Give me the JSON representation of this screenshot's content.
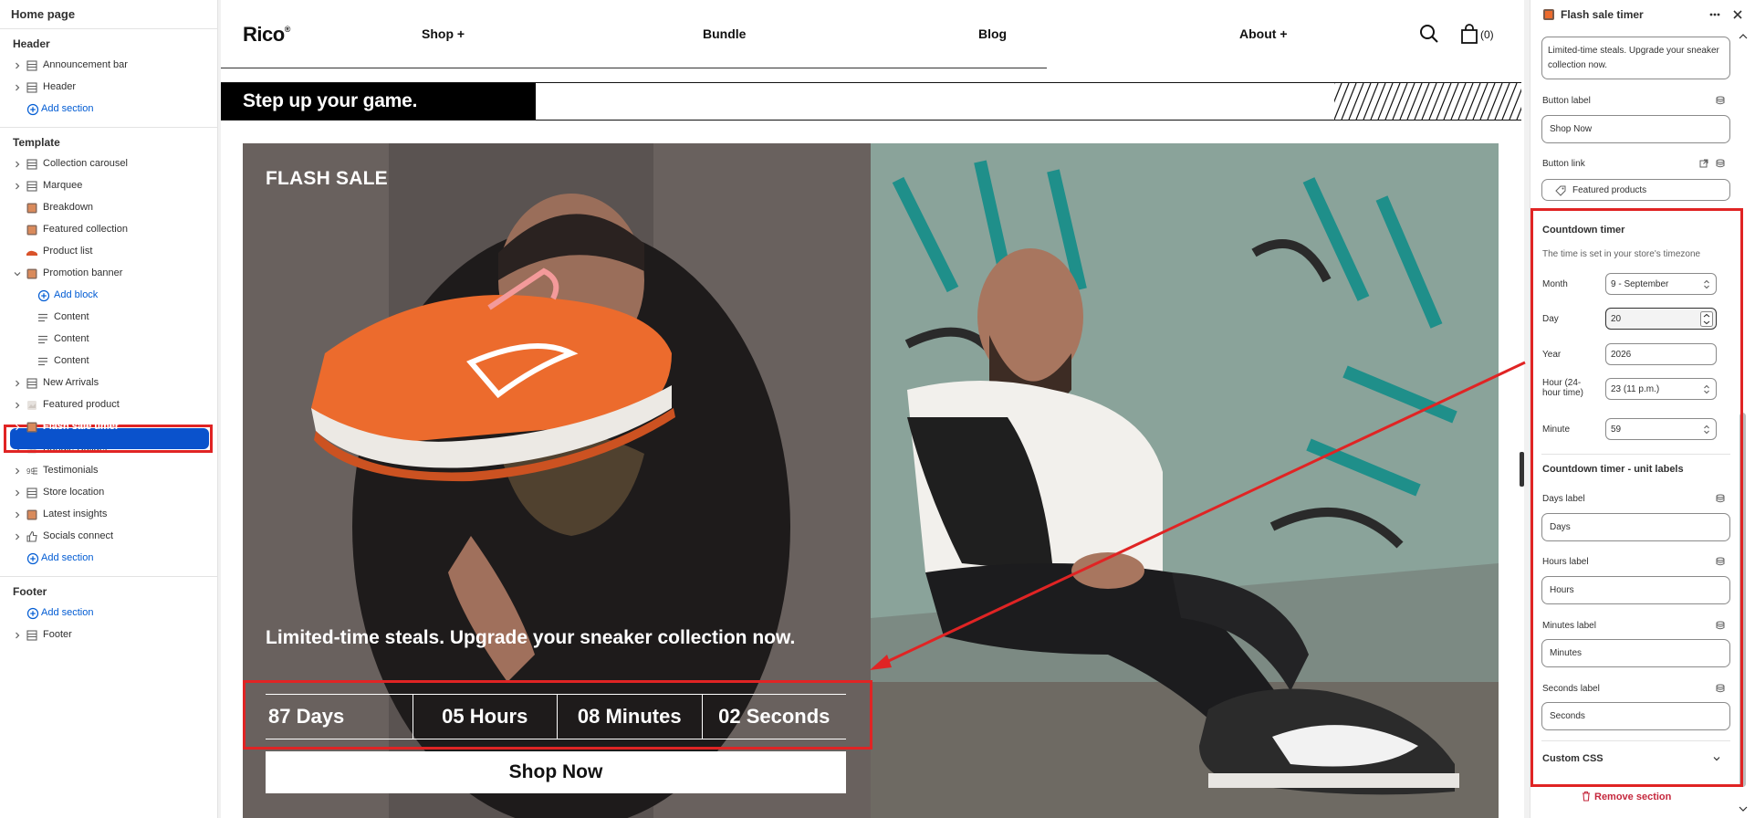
{
  "sidebar": {
    "page_title": "Home page",
    "header_group": {
      "title": "Header",
      "items": [
        {
          "label": "Announcement bar",
          "icon": "section-icon"
        },
        {
          "label": "Header",
          "icon": "section-icon"
        }
      ],
      "add_label": "Add section"
    },
    "template_group": {
      "title": "Template",
      "items": [
        {
          "label": "Collection carousel",
          "icon": "section-icon"
        },
        {
          "label": "Marquee",
          "icon": "section-icon"
        },
        {
          "label": "Breakdown",
          "icon": "image-icon"
        },
        {
          "label": "Featured collection",
          "icon": "image-icon"
        },
        {
          "label": "Product list",
          "icon": "shoe-icon"
        },
        {
          "label": "Promotion banner",
          "icon": "image-icon"
        },
        {
          "label": "Add block",
          "icon": "add-icon"
        },
        {
          "label": "Content",
          "icon": "text-icon"
        },
        {
          "label": "Content",
          "icon": "text-icon"
        },
        {
          "label": "Content",
          "icon": "text-icon"
        },
        {
          "label": "New Arrivals",
          "icon": "section-icon"
        },
        {
          "label": "Featured product",
          "icon": "product-icon"
        },
        {
          "label": "Flash sale timer",
          "icon": "image-icon"
        },
        {
          "label": "Bundle Builder",
          "icon": "product-icon"
        },
        {
          "label": "Testimonials",
          "icon": "list-icon"
        },
        {
          "label": "Store location",
          "icon": "section-icon"
        },
        {
          "label": "Latest insights",
          "icon": "image-icon"
        },
        {
          "label": "Socials connect",
          "icon": "thumb-icon"
        }
      ],
      "add_label": "Add section"
    },
    "footer_group": {
      "title": "Footer",
      "add_label": "Add section",
      "items": [
        {
          "label": "Footer",
          "icon": "section-icon"
        }
      ]
    }
  },
  "preview": {
    "logo": "Rico",
    "logo_mark": "®",
    "nav": [
      "Shop +",
      "Bundle",
      "Blog",
      "About +"
    ],
    "cart_count": "(0)",
    "marquee_text": "Step up your game.",
    "banner": {
      "title": "FLASH SALE",
      "text": "Limited-time steals. Upgrade your sneaker collection now.",
      "timer": [
        "87 Days",
        "05 Hours",
        "08 Minutes",
        "02 Seconds"
      ],
      "button": "Shop Now"
    }
  },
  "settings": {
    "title": "Flash sale timer",
    "text_value": "Limited-time steals. Upgrade your sneaker collection now.",
    "button_label_label": "Button label",
    "button_label_value": "Shop Now",
    "button_link_label": "Button link",
    "button_link_value": "Featured products",
    "countdown_title": "Countdown timer",
    "countdown_help": "The time is set in your store's timezone",
    "month_label": "Month",
    "month_value": "9 - September",
    "day_label": "Day",
    "day_value": "20",
    "year_label": "Year",
    "year_value": "2026",
    "hour_label": "Hour (24-hour time)",
    "hour_value": "23 (11 p.m.)",
    "minute_label": "Minute",
    "minute_value": "59",
    "unit_labels_title": "Countdown timer - unit labels",
    "days_label_label": "Days label",
    "days_label_value": "Days",
    "hours_label_label": "Hours label",
    "hours_label_value": "Hours",
    "minutes_label_label": "Minutes label",
    "minutes_label_value": "Minutes",
    "seconds_label_label": "Seconds label",
    "seconds_label_value": "Seconds",
    "custom_css": "Custom CSS",
    "remove_section": "Remove section"
  },
  "colors": {
    "accent": "#005bd3",
    "selected": "#0a52cc",
    "highlight": "#e02424",
    "remove": "#c5283d"
  }
}
